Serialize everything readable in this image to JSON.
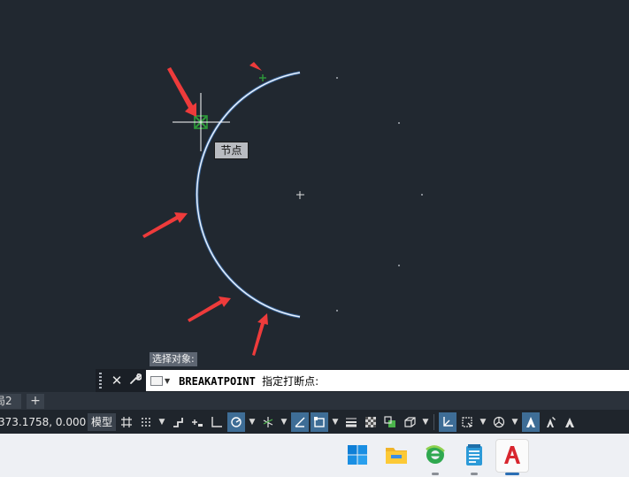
{
  "canvas": {
    "tooltip": "节点",
    "prompt_history": "选择对象:"
  },
  "command_line": {
    "command": "BREAKATPOINT",
    "prompt": "指定打断点:"
  },
  "layout_tabs": {
    "current_partial": "局2",
    "add_label": "+"
  },
  "status_bar": {
    "coordinates": "373.1758, 0.0000",
    "model_label": "模型"
  },
  "colors": {
    "canvas_bg": "#212830",
    "arc": "#e8f2ff",
    "arc_glow": "#4a8fe6",
    "arrow": "#ee3b3b",
    "grip": "#2e9b3a",
    "active_toggle": "#3e6d96"
  },
  "icons": {
    "command_line": [
      "grip-handle-icon",
      "close-icon",
      "wrench-icon",
      "command-picker-icon",
      "chevron-down-icon"
    ],
    "status_bar": [
      "grid-icon",
      "snap-icon",
      "infer-constraints-icon",
      "dynamic-input-icon",
      "ortho-icon",
      "polar-tracking-icon",
      "isometric-icon",
      "object-snap-tracking-icon",
      "object-snap-icon",
      "lineweight-icon",
      "transparency-icon",
      "selection-cycling-icon",
      "3d-osnap-icon",
      "dynamic-ucs-icon",
      "selection-filter-icon",
      "gizmo-icon",
      "annotation-visibility-icon",
      "auto-scale-icon",
      "annotation-scale-icon"
    ],
    "taskbar": [
      "windows-start-icon",
      "file-explorer-icon",
      "browser-icon",
      "notepad-icon",
      "autocad-icon"
    ]
  }
}
